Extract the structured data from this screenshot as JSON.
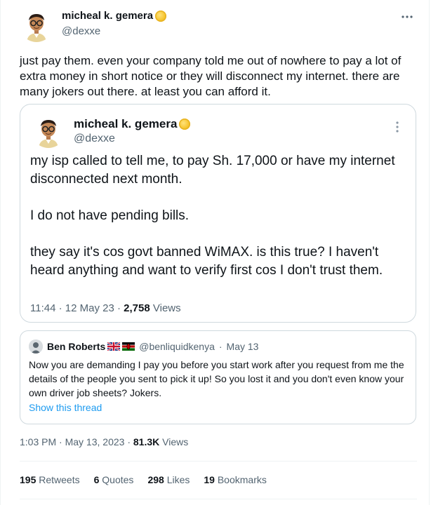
{
  "colors": {
    "text": "#0f1419",
    "secondary": "#536471",
    "link": "#1d9bf0",
    "border": "#cfd9de",
    "divider": "#eff3f4"
  },
  "tweet": {
    "author": {
      "name": "micheal k. gemera",
      "handle": "@dexxe",
      "badge_icon": "coin-emoji-icon",
      "avatar_icon": "cartoon-avatar-icon"
    },
    "menu_icon": "more-horizontal-icon",
    "text": "just pay them. even your company told me out of nowhere to pay a lot of extra money in short notice or they will disconnect my internet.  there are many jokers out there. at least you can afford it.",
    "timestamp": {
      "time": "1:03 PM",
      "date": "May 13, 2023",
      "views_count": "81.3K",
      "views_label": "Views"
    },
    "stats": {
      "retweets": {
        "count": "195",
        "label": "Retweets"
      },
      "quotes": {
        "count": "6",
        "label": "Quotes"
      },
      "likes": {
        "count": "298",
        "label": "Likes"
      },
      "bookmarks": {
        "count": "19",
        "label": "Bookmarks"
      }
    }
  },
  "quoted_tweet": {
    "author": {
      "name": "micheal k. gemera",
      "handle": "@dexxe",
      "badge_icon": "coin-emoji-icon",
      "avatar_icon": "cartoon-avatar-icon"
    },
    "menu_icon": "more-vertical-icon",
    "paragraphs": [
      "my isp called to tell me, to pay Sh. 17,000 or have my internet disconnected next month.",
      "I do not have pending bills.",
      "they say it's cos govt banned WiMAX. is this true? I haven't heard anything and want to verify first cos I don't trust them."
    ],
    "meta": {
      "time": "11:44",
      "date": "12 May 23",
      "views_count": "2,758",
      "views_label": "Views"
    }
  },
  "embedded_tweet": {
    "author_name": "Ben Roberts",
    "flags": [
      "uk-flag-icon",
      "kenya-flag-icon"
    ],
    "handle": "@benliquidkenya",
    "date": "May 13",
    "text": "Now you are demanding I pay you before you start work after you request from me the details of the people you sent to pick it up!  So you lost it and you don't even know your own driver job sheets? Jokers.",
    "show_thread_label": "Show this thread"
  }
}
